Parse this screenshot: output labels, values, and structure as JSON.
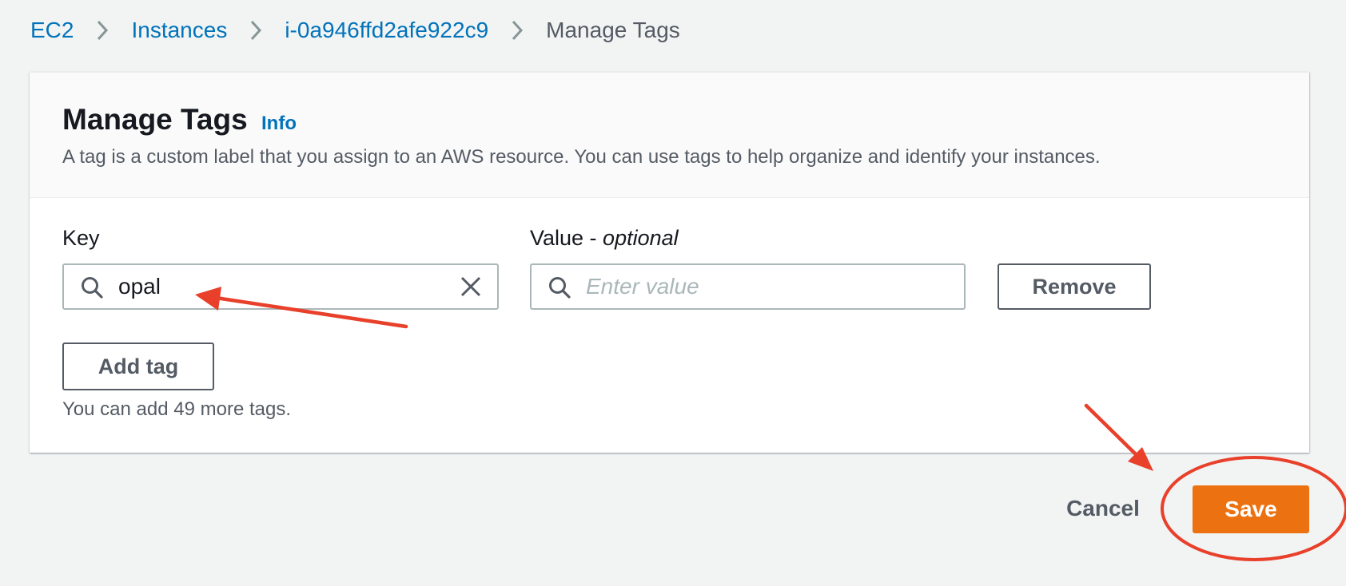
{
  "breadcrumb": {
    "items": [
      {
        "label": "EC2"
      },
      {
        "label": "Instances"
      },
      {
        "label": "i-0a946ffd2afe922c9"
      },
      {
        "label": "Manage Tags"
      }
    ]
  },
  "panel": {
    "title": "Manage Tags",
    "info_link": "Info",
    "description": "A tag is a custom label that you assign to an AWS resource. You can use tags to help organize and identify your instances."
  },
  "tags": {
    "key_label": "Key",
    "value_label": "Value - ",
    "value_label_optional": "optional",
    "key_value": "opal",
    "value_placeholder": "Enter value",
    "remove_label": "Remove",
    "add_tag_label": "Add tag",
    "hint": "You can add 49 more tags."
  },
  "footer": {
    "cancel_label": "Cancel",
    "save_label": "Save"
  },
  "colors": {
    "link": "#0073bb",
    "primary_button": "#ec7211",
    "annotation": "#e8402a",
    "background": "#f2f3f3"
  }
}
